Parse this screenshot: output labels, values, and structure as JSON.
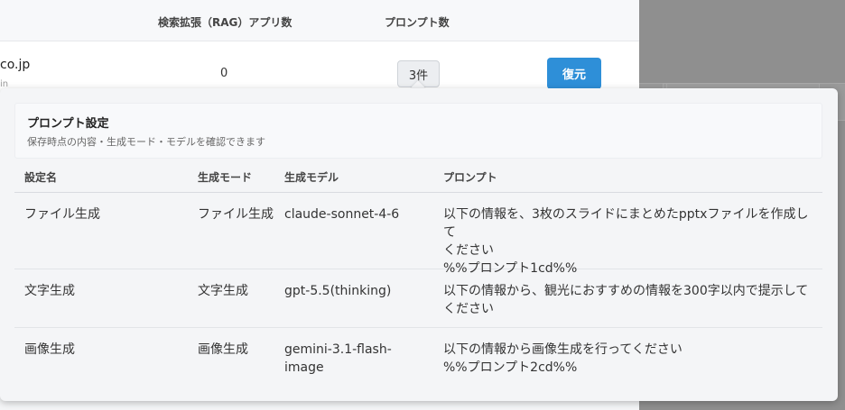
{
  "background_table": {
    "headers": {
      "rag_apps": "検索拡張（RAG）アプリ数",
      "prompts": "プロンプト数"
    },
    "row": {
      "email": "co.jp",
      "email_sub": "in",
      "rag_count": "0",
      "prompt_count_button": "3件",
      "restore_button": "復元"
    }
  },
  "popover": {
    "title": "プロンプト設定",
    "subtitle": "保存時点の内容・生成モード・モデルを確認できます",
    "columns": [
      "設定名",
      "生成モード",
      "生成モデル",
      "プロンプト"
    ],
    "rows": [
      {
        "name": "ファイル生成",
        "mode": "ファイル生成",
        "model": "claude-sonnet-4-6",
        "prompt": "以下の情報を、3枚のスライドにまとめたpptxファイルを作成して\nください\n%%プロンプト1cd%%"
      },
      {
        "name": "文字生成",
        "mode": "文字生成",
        "model": "gpt-5.5(thinking)",
        "prompt": "以下の情報から、観光におすすめの情報を300字以内で提示して\nください"
      },
      {
        "name": "画像生成",
        "mode": "画像生成",
        "model": "gemini-3.1-flash-\nimage",
        "prompt": "以下の情報から画像生成を行ってください\n%%プロンプト2cd%%"
      }
    ]
  },
  "colors": {
    "accent": "#2e8fd8",
    "overlay": "#8f8f8f"
  }
}
